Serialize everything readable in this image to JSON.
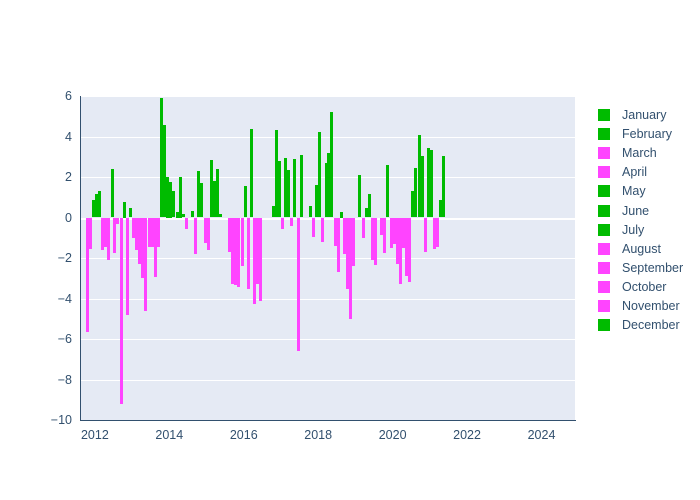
{
  "chart_data": {
    "type": "bar",
    "title": "",
    "subtitle": "",
    "xlabel": "",
    "ylabel": "",
    "xlim": [
      2011.6,
      2024.9
    ],
    "ylim": [
      -10,
      6
    ],
    "grid": true,
    "legend_position": "right",
    "y_ticks": [
      6,
      4,
      2,
      0,
      -2,
      -4,
      -6,
      -8,
      -10
    ],
    "y_tick_labels": [
      "6",
      "4",
      "2",
      "0",
      "−2",
      "−4",
      "−6",
      "−8",
      "−10"
    ],
    "x_ticks": [
      2012,
      2014,
      2016,
      2018,
      2020,
      2022,
      2024
    ],
    "x_tick_labels": [
      "2012",
      "2014",
      "2016",
      "2018",
      "2020",
      "2022",
      "2024"
    ],
    "colors": {
      "positive_month": "#00bb00",
      "negative_month": "#ff44ff",
      "plot_background": "#e5eaf4",
      "gridline": "#ffffff",
      "text": "#32506e",
      "page_background": "#ffffff"
    },
    "legend_entries": [
      {
        "label": "January",
        "color": "#00bb00"
      },
      {
        "label": "February",
        "color": "#00bb00"
      },
      {
        "label": "March",
        "color": "#ff44ff"
      },
      {
        "label": "April",
        "color": "#ff44ff"
      },
      {
        "label": "May",
        "color": "#00bb00"
      },
      {
        "label": "June",
        "color": "#00bb00"
      },
      {
        "label": "July",
        "color": "#00bb00"
      },
      {
        "label": "August",
        "color": "#ff44ff"
      },
      {
        "label": "September",
        "color": "#ff44ff"
      },
      {
        "label": "October",
        "color": "#ff44ff"
      },
      {
        "label": "November",
        "color": "#ff44ff"
      },
      {
        "label": "December",
        "color": "#00bb00"
      }
    ],
    "bars": [
      {
        "x": 2011.79,
        "y": -5.65
      },
      {
        "x": 2011.87,
        "y": -1.55
      },
      {
        "x": 2011.96,
        "y": 0.85
      },
      {
        "x": 2012.04,
        "y": 1.15
      },
      {
        "x": 2012.12,
        "y": 1.3
      },
      {
        "x": 2012.21,
        "y": -1.6
      },
      {
        "x": 2012.29,
        "y": -1.45
      },
      {
        "x": 2012.37,
        "y": -2.1
      },
      {
        "x": 2012.46,
        "y": 2.4
      },
      {
        "x": 2012.54,
        "y": -1.75
      },
      {
        "x": 2012.62,
        "y": -0.3
      },
      {
        "x": 2012.71,
        "y": -9.2
      },
      {
        "x": 2012.79,
        "y": 0.75
      },
      {
        "x": 2012.87,
        "y": -4.8
      },
      {
        "x": 2012.96,
        "y": 0.45
      },
      {
        "x": 2013.04,
        "y": -1.0
      },
      {
        "x": 2013.12,
        "y": -1.6
      },
      {
        "x": 2013.21,
        "y": -2.3
      },
      {
        "x": 2013.29,
        "y": -3.0
      },
      {
        "x": 2013.37,
        "y": -4.6
      },
      {
        "x": 2013.46,
        "y": -1.45
      },
      {
        "x": 2013.54,
        "y": -1.45
      },
      {
        "x": 2013.62,
        "y": -2.95
      },
      {
        "x": 2013.71,
        "y": -1.45
      },
      {
        "x": 2013.79,
        "y": 5.9
      },
      {
        "x": 2013.87,
        "y": 4.55
      },
      {
        "x": 2013.96,
        "y": 2.0
      },
      {
        "x": 2014.04,
        "y": 1.75
      },
      {
        "x": 2014.12,
        "y": 1.3
      },
      {
        "x": 2014.21,
        "y": 0.25
      },
      {
        "x": 2014.29,
        "y": 2.0
      },
      {
        "x": 2014.37,
        "y": 0.15
      },
      {
        "x": 2014.46,
        "y": -0.55
      },
      {
        "x": 2014.62,
        "y": 0.3
      },
      {
        "x": 2014.71,
        "y": -1.8
      },
      {
        "x": 2014.79,
        "y": 2.3
      },
      {
        "x": 2014.87,
        "y": 1.7
      },
      {
        "x": 2014.96,
        "y": -1.25
      },
      {
        "x": 2015.04,
        "y": -1.6
      },
      {
        "x": 2015.12,
        "y": 2.85
      },
      {
        "x": 2015.21,
        "y": 1.8
      },
      {
        "x": 2015.29,
        "y": 2.4
      },
      {
        "x": 2015.37,
        "y": 0.15
      },
      {
        "x": 2015.62,
        "y": -1.7
      },
      {
        "x": 2015.71,
        "y": -3.3
      },
      {
        "x": 2015.79,
        "y": -3.35
      },
      {
        "x": 2015.87,
        "y": -3.45
      },
      {
        "x": 2015.96,
        "y": -2.4
      },
      {
        "x": 2016.04,
        "y": 1.55
      },
      {
        "x": 2016.12,
        "y": -3.55
      },
      {
        "x": 2016.21,
        "y": 4.35
      },
      {
        "x": 2016.29,
        "y": -4.25
      },
      {
        "x": 2016.37,
        "y": -3.3
      },
      {
        "x": 2016.46,
        "y": -4.1
      },
      {
        "x": 2016.79,
        "y": 0.55
      },
      {
        "x": 2016.87,
        "y": 4.3
      },
      {
        "x": 2016.96,
        "y": 2.8
      },
      {
        "x": 2017.04,
        "y": -0.55
      },
      {
        "x": 2017.12,
        "y": 2.95
      },
      {
        "x": 2017.21,
        "y": 2.35
      },
      {
        "x": 2017.29,
        "y": -0.4
      },
      {
        "x": 2017.37,
        "y": 2.9
      },
      {
        "x": 2017.46,
        "y": -6.6
      },
      {
        "x": 2017.54,
        "y": 3.1
      },
      {
        "x": 2017.79,
        "y": 0.55
      },
      {
        "x": 2017.87,
        "y": -0.95
      },
      {
        "x": 2017.96,
        "y": 1.6
      },
      {
        "x": 2018.04,
        "y": 4.2
      },
      {
        "x": 2018.12,
        "y": -1.2
      },
      {
        "x": 2018.21,
        "y": 2.7
      },
      {
        "x": 2018.29,
        "y": 3.2
      },
      {
        "x": 2018.37,
        "y": 5.2
      },
      {
        "x": 2018.46,
        "y": -1.4
      },
      {
        "x": 2018.54,
        "y": -2.7
      },
      {
        "x": 2018.62,
        "y": 0.25
      },
      {
        "x": 2018.71,
        "y": -1.8
      },
      {
        "x": 2018.79,
        "y": -3.55
      },
      {
        "x": 2018.87,
        "y": -5.0
      },
      {
        "x": 2018.96,
        "y": -2.4
      },
      {
        "x": 2019.12,
        "y": 2.1
      },
      {
        "x": 2019.21,
        "y": -1.0
      },
      {
        "x": 2019.29,
        "y": 0.45
      },
      {
        "x": 2019.37,
        "y": 1.15
      },
      {
        "x": 2019.46,
        "y": -2.1
      },
      {
        "x": 2019.54,
        "y": -2.35
      },
      {
        "x": 2019.71,
        "y": -0.85
      },
      {
        "x": 2019.79,
        "y": -1.75
      },
      {
        "x": 2019.87,
        "y": 2.6
      },
      {
        "x": 2019.96,
        "y": -1.5
      },
      {
        "x": 2020.04,
        "y": -1.3
      },
      {
        "x": 2020.12,
        "y": -2.3
      },
      {
        "x": 2020.21,
        "y": -3.3
      },
      {
        "x": 2020.29,
        "y": -1.5
      },
      {
        "x": 2020.37,
        "y": -2.9
      },
      {
        "x": 2020.46,
        "y": -3.2
      },
      {
        "x": 2020.54,
        "y": 1.3
      },
      {
        "x": 2020.62,
        "y": 2.45
      },
      {
        "x": 2020.71,
        "y": 4.05
      },
      {
        "x": 2020.79,
        "y": 3.05
      },
      {
        "x": 2020.87,
        "y": -1.7
      },
      {
        "x": 2020.96,
        "y": 3.45
      },
      {
        "x": 2021.04,
        "y": 3.35
      },
      {
        "x": 2021.12,
        "y": -1.55
      },
      {
        "x": 2021.21,
        "y": -1.45
      },
      {
        "x": 2021.29,
        "y": 0.85
      },
      {
        "x": 2021.37,
        "y": 3.05
      }
    ]
  }
}
